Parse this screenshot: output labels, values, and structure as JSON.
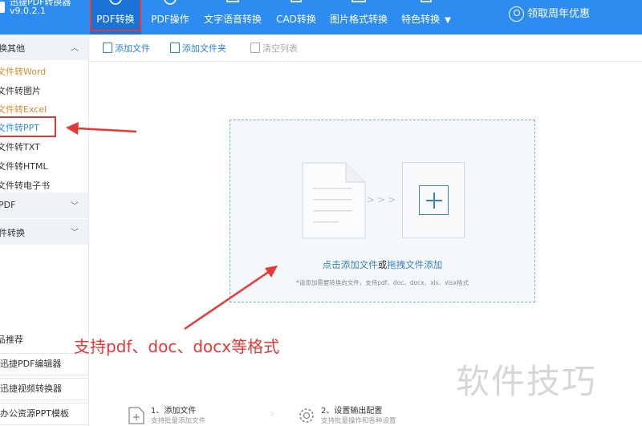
{
  "app": {
    "name": "迅捷PDF转换器",
    "version": "v9.0.2.1"
  },
  "tabs": [
    {
      "label": "PDF转换",
      "icon": "pdf-convert-icon",
      "active": true
    },
    {
      "label": "PDF操作",
      "icon": "pdf-operate-icon",
      "active": false
    },
    {
      "label": "文字语音转换",
      "icon": "text-speech-icon",
      "active": false
    },
    {
      "label": "CAD转换",
      "icon": "cad-icon",
      "active": false
    },
    {
      "label": "图片格式转换",
      "icon": "image-icon",
      "active": false
    },
    {
      "label": "特色转换",
      "icon": "feature-icon",
      "active": false
    }
  ],
  "promo_label": "领取周年优惠",
  "sidebar": {
    "section1": "换其他",
    "items": [
      {
        "label": "文件转Word",
        "color": "orange"
      },
      {
        "label": "文件转图片",
        "color": "dark"
      },
      {
        "label": "文件转Excel",
        "color": "orange"
      },
      {
        "label": "文件转PPT",
        "color": "blue"
      },
      {
        "label": "文件转TXT",
        "color": "dark"
      },
      {
        "label": "文件转HTML",
        "color": "dark"
      },
      {
        "label": "文件转电子书",
        "color": "dark"
      }
    ],
    "section2": "PDF",
    "section3": "件转换",
    "recommend_title": "品推荐",
    "recommend": [
      "迅捷PDF编辑器",
      "迅捷视频转换器",
      "办公资源PPT模板"
    ]
  },
  "toolbar": {
    "add_file": "添加文件",
    "add_folder": "添加文件夹",
    "clear_list": "清空列表"
  },
  "drop": {
    "link1": "点击添加文件",
    "or": "或",
    "link2": "拖拽文件添加",
    "hint": "*请添加需要转换的文件，支持pdf、doc、docx、xls、xlsx格式"
  },
  "annotation": "支持pdf、doc、docx等格式",
  "watermark": "软件技巧",
  "steps": [
    {
      "title": "1、添加文件",
      "subtitle": "支持批量添加文件"
    },
    {
      "title": "2、设置输出配置",
      "subtitle": "支持批量操作和各种设置"
    }
  ],
  "colors": {
    "topbar": "#2d8cf0",
    "active_tab": "#1a72d6",
    "annotation_red": "#e53935",
    "link_blue": "#3a82b7"
  }
}
